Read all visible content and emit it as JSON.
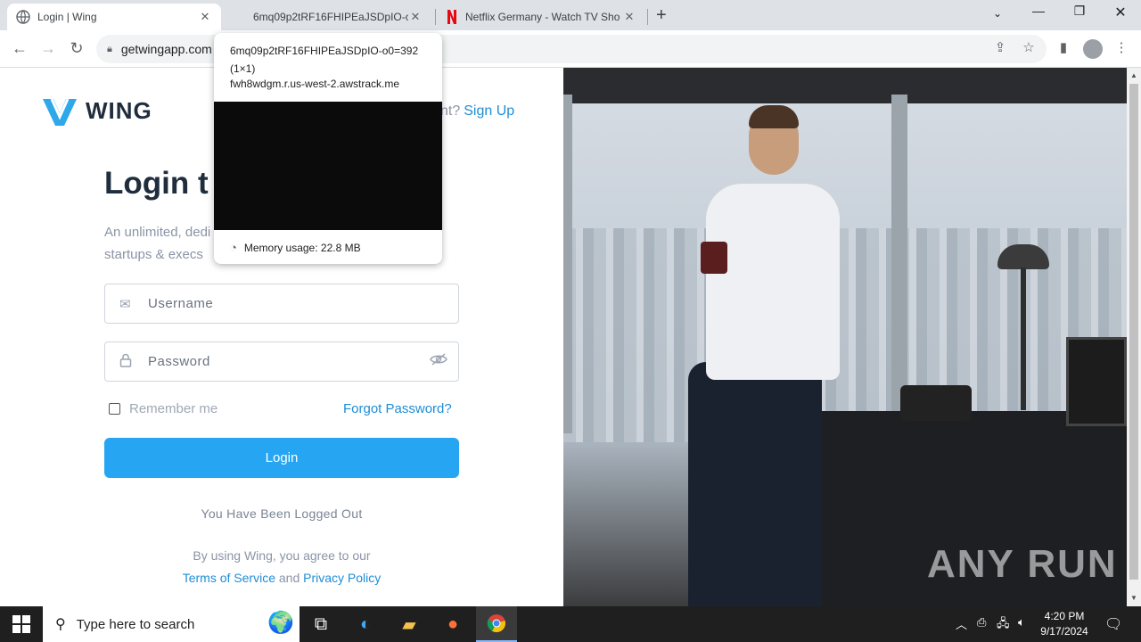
{
  "browser": {
    "tabs": [
      {
        "title": "Login | Wing",
        "active": true
      },
      {
        "title": "6mq09p2tRF16FHIPEaJSDpIO-o0",
        "active": false
      },
      {
        "title": "Netflix Germany - Watch TV Sho",
        "active": false
      }
    ],
    "url": "getwingapp.com",
    "tooltip": {
      "title": "6mq09p2tRF16FHIPEaJSDpIO-o0=392 (1×1)",
      "domain": "fwh8wdgm.r.us-west-2.awstrack.me",
      "memory": "Memory usage: 22.8 MB"
    }
  },
  "page": {
    "logo_text": "WING",
    "signup_prefix": "nt?",
    "signup_link": "Sign Up",
    "title": "Login t",
    "subtitle_line1": "An unlimited, dedi",
    "subtitle_line2": "startups & execs",
    "username_placeholder": "Username",
    "password_placeholder": "Password",
    "remember_label": "Remember me",
    "forgot_label": "Forgot Password?",
    "login_button": "Login",
    "logged_out_message": "You Have Been Logged Out",
    "terms_prefix": "By using Wing, you agree to our",
    "terms_link": "Terms of Service",
    "terms_and": "and",
    "privacy_link": "Privacy Policy",
    "watermark": "ANY RUN"
  },
  "taskbar": {
    "search_placeholder": "Type here to search",
    "time": "4:20 PM",
    "date": "9/17/2024"
  },
  "colors": {
    "accent": "#25a5f2",
    "link": "#1f8dd6",
    "heading": "#1f2d3d"
  }
}
